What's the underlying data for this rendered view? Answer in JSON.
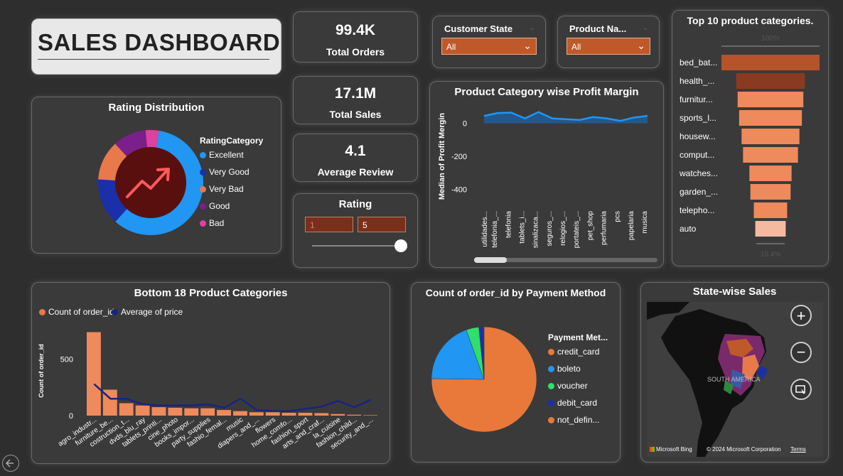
{
  "header": {
    "title": "SALES DASHBOARD"
  },
  "kpis": [
    {
      "value": "99.4K",
      "label": "Total Orders"
    },
    {
      "value": "17.1M",
      "label": "Total Sales"
    },
    {
      "value": "4.1",
      "label": "Average Review"
    }
  ],
  "slicers": {
    "customer_state": {
      "title": "Customer State",
      "value": "All"
    },
    "product_name": {
      "title": "Product Na...",
      "value": "All"
    },
    "rating": {
      "title": "Rating",
      "min": "1",
      "max": "5"
    }
  },
  "colors": {
    "accent": "#e8794a",
    "dark_orange": "#c0592a",
    "blue": "#2196f3",
    "navy": "#1a237e"
  },
  "chart_data": [
    {
      "id": "rating_distribution",
      "type": "pie",
      "title": "Rating Distribution",
      "legend_title": "RatingCategory",
      "labels": [
        "Excellent",
        "Very Good",
        "Very Bad",
        "Good",
        "Bad"
      ],
      "values": [
        58,
        14,
        12,
        10,
        4
      ],
      "colors": [
        "#2196f3",
        "#1a2fa8",
        "#e8794a",
        "#7b1f8a",
        "#e040a0"
      ],
      "center_icon": "trend-up-icon"
    },
    {
      "id": "profit_margin",
      "type": "area",
      "title": "Product Category wise Profit Margin",
      "ylabel": "Median of Profit Mergin",
      "yticks": [
        "0",
        "-200",
        "-400"
      ],
      "ylim": [
        -480,
        80
      ],
      "categories": [
        "utilidades...",
        "telefonia_...",
        "telefonia",
        "tablets_i...",
        "sinalizaca...",
        "seguros_...",
        "relogios_...",
        "portateis_...",
        "pet_shop",
        "perfumaria",
        "pcs",
        "papelaria",
        "musica"
      ],
      "values": [
        45,
        62,
        65,
        30,
        68,
        30,
        25,
        20,
        38,
        30,
        15,
        35,
        45
      ]
    },
    {
      "id": "top10_categories",
      "type": "bar",
      "title": "Top 10 product categories.",
      "top_label": "100%",
      "bottom_label": "10.4%",
      "categories": [
        "bed_bat...",
        "health_...",
        "furnitur...",
        "sports_l...",
        "housew...",
        "comput...",
        "watches...",
        "garden_...",
        "telepho...",
        "auto"
      ],
      "values": [
        100,
        70,
        67,
        64,
        59,
        56,
        43,
        41,
        34,
        31
      ],
      "colors": [
        "#b5532a",
        "#8a3a20",
        "#ee8a5c",
        "#ee8a5c",
        "#ee8a5c",
        "#ee8a5c",
        "#ee8a5c",
        "#ee8a5c",
        "#ee8a5c",
        "#f5b9a0"
      ]
    },
    {
      "id": "bottom18",
      "type": "bar",
      "title": "Bottom 18 Product Categories",
      "ylabel": "Count of order_id",
      "yticks": [
        "500",
        "0"
      ],
      "ylim": [
        0,
        800
      ],
      "series_names": [
        "Count of order_id",
        "Average of price"
      ],
      "categories": [
        "agro_industr...",
        "furniture_be...",
        "costruction_t...",
        "dvds_blu_ray",
        "tablets_printi...",
        "cine_photo",
        "books_impor...",
        "party_supplies",
        "fashio_femal...",
        "music",
        "diapers_and_...",
        "flowers",
        "home_comfo...",
        "fashion_sport",
        "arts_and_craf...",
        "la_cuisine",
        "fashion_child...",
        "security_and_..."
      ],
      "counts": [
        740,
        230,
        110,
        90,
        75,
        70,
        65,
        65,
        50,
        40,
        30,
        30,
        25,
        25,
        22,
        14,
        8,
        4
      ],
      "avg_price": [
        280,
        150,
        150,
        100,
        90,
        90,
        90,
        100,
        70,
        150,
        50,
        40,
        40,
        60,
        80,
        130,
        75,
        140
      ]
    },
    {
      "id": "payment_method",
      "type": "pie",
      "title": "Count of order_id by Payment Method",
      "legend_title": "Payment Met...",
      "labels": [
        "credit_card",
        "boleto",
        "voucher",
        "debit_card",
        "not_defin..."
      ],
      "values": [
        75.3,
        19.3,
        3.9,
        1.5,
        0.1
      ],
      "colors": [
        "#e8793a",
        "#2196f3",
        "#2ee06a",
        "#1a2fa8",
        "#e8793a"
      ]
    }
  ],
  "map": {
    "title": "State-wise Sales",
    "region_label": "SOUTH AMERICA",
    "attribution": "© 2024 Microsoft Corporation",
    "terms": "Terms",
    "brand": "Microsoft Bing",
    "zoom_in": "+",
    "zoom_out": "−"
  }
}
